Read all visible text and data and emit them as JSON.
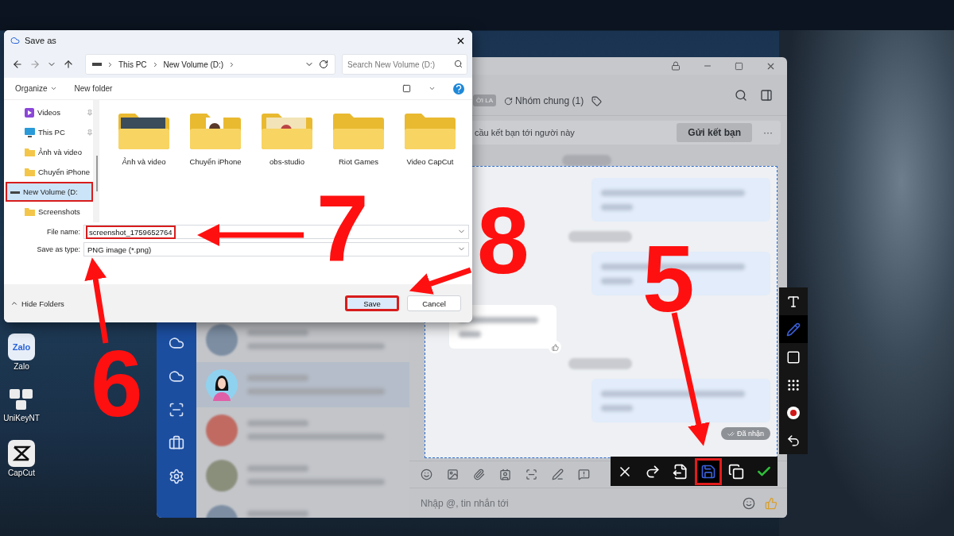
{
  "desktop_icons": [
    {
      "kind": "zalo",
      "label": "Zalo",
      "logo_text": "Zalo"
    },
    {
      "kind": "unikey",
      "label": "UniKeyNT"
    },
    {
      "kind": "capcut",
      "label": "CapCut"
    }
  ],
  "chat_window": {
    "header": {
      "badge": "ỜI LA",
      "group_link": "Nhóm chung (1)"
    },
    "friend_bar": {
      "text": "cầu kết bạn tới người này",
      "button": "Gửi kết bạn",
      "more": "···"
    },
    "chats": [
      {
        "kind": "blurred",
        "selected": false
      },
      {
        "kind": "silhouette",
        "selected": true
      },
      {
        "kind": "red",
        "selected": false
      },
      {
        "kind": "group",
        "selected": false
      },
      {
        "kind": "blurred",
        "selected": false
      }
    ],
    "messages": [
      {
        "kind": "pill"
      },
      {
        "kind": "outgoing"
      },
      {
        "kind": "pill"
      },
      {
        "kind": "outgoing"
      },
      {
        "kind": "incoming"
      },
      {
        "kind": "pill"
      },
      {
        "kind": "outgoing"
      }
    ],
    "status": "Đã nhận",
    "input": {
      "placeholder": "Nhập @, tin nhắn tới"
    }
  },
  "capture_tools": [
    {
      "kind": "text",
      "selected": false
    },
    {
      "kind": "pen",
      "selected": true
    },
    {
      "kind": "rect",
      "selected": false
    },
    {
      "kind": "mosaic",
      "selected": false
    },
    {
      "kind": "dot",
      "selected": false
    },
    {
      "kind": "undo",
      "selected": false
    }
  ],
  "capture_actions": [
    {
      "kind": "close",
      "highlighted": false
    },
    {
      "kind": "share",
      "highlighted": false
    },
    {
      "kind": "export",
      "highlighted": false
    },
    {
      "kind": "save",
      "highlighted": true
    },
    {
      "kind": "copy",
      "highlighted": false
    },
    {
      "kind": "confirm",
      "highlighted": false
    }
  ],
  "dialog": {
    "title": "Save as",
    "breadcrumb": [
      "This PC",
      "New Volume (D:)"
    ],
    "search": {
      "placeholder": "Search New Volume (D:)"
    },
    "organize": "Organize",
    "new_folder": "New folder",
    "nav": [
      {
        "kind": "videos",
        "label": "Videos",
        "pinned": true,
        "selected": false,
        "highlighted": false
      },
      {
        "kind": "pc",
        "label": "This PC",
        "pinned": true,
        "selected": false,
        "highlighted": false
      },
      {
        "kind": "folder",
        "label": "Ảnh và video",
        "pinned": false,
        "selected": false,
        "highlighted": false
      },
      {
        "kind": "folder",
        "label": "Chuyển iPhone",
        "pinned": false,
        "selected": false,
        "highlighted": false
      },
      {
        "kind": "drive",
        "label": "New Volume (D:",
        "pinned": false,
        "selected": true,
        "highlighted": true
      },
      {
        "kind": "folder",
        "label": "Screenshots",
        "pinned": false,
        "selected": false,
        "highlighted": false
      }
    ],
    "folders": [
      {
        "kind": "photos",
        "label": "Ảnh và video"
      },
      {
        "kind": "paper",
        "label": "Chuyển iPhone"
      },
      {
        "kind": "stamp",
        "label": "obs-studio"
      },
      {
        "kind": "plain",
        "label": "Riot Games"
      },
      {
        "kind": "plain",
        "label": "Video CapCut"
      }
    ],
    "file_name": {
      "label": "File name:",
      "value": "screenshot_1759652764",
      "highlighted": true
    },
    "save_type": {
      "label": "Save as type:",
      "value": "PNG image (*.png)"
    },
    "hide_folders": "Hide Folders",
    "buttons": [
      {
        "kind": "primary",
        "label": "Save",
        "highlighted": true
      },
      {
        "kind": "secondary",
        "label": "Cancel",
        "highlighted": false
      }
    ]
  },
  "annotations": [
    {
      "label": "5"
    },
    {
      "label": "6"
    },
    {
      "label": "7"
    },
    {
      "label": "8"
    }
  ]
}
